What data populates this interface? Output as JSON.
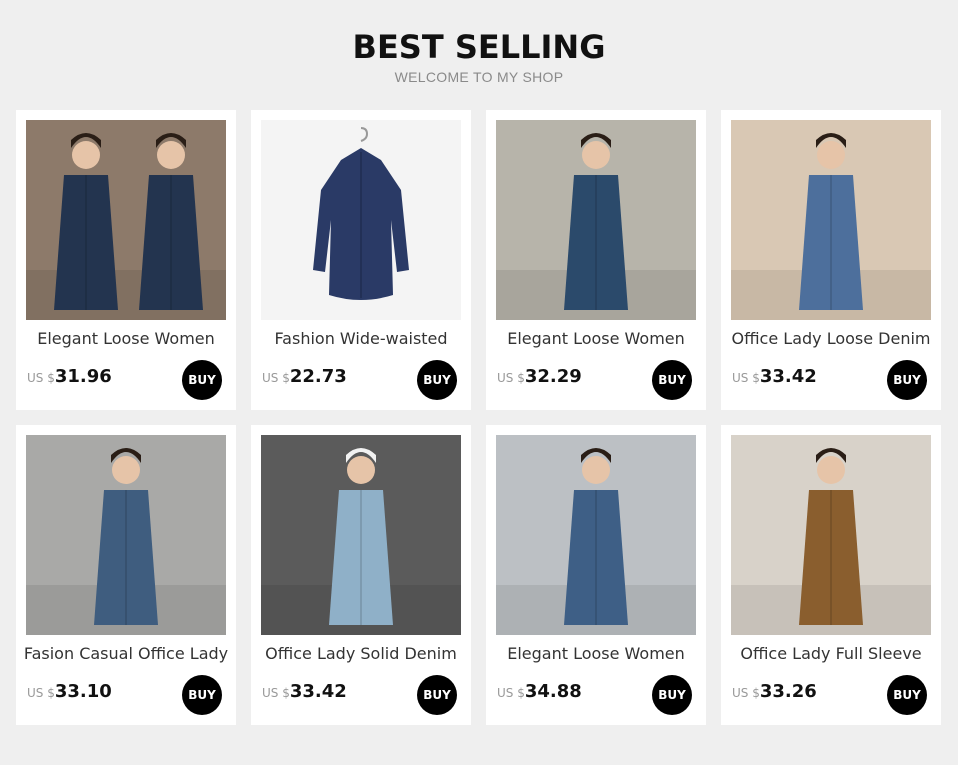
{
  "header": {
    "title": "BEST SELLING",
    "subtitle": "WELCOME TO MY SHOP"
  },
  "currency_label": "US $",
  "buy_label": "BUY",
  "products": [
    {
      "name": "Elegant Loose Women",
      "price": "31.96",
      "image": "woman-denim-trench-front-and-back-photo",
      "colors": {
        "bg": "#8d7a6a",
        "garment": "#23344f"
      }
    },
    {
      "name": "Fashion Wide-waisted",
      "price": "22.73",
      "image": "navy-shirt-dress-on-hanger-photo",
      "colors": {
        "bg": "#f4f4f4",
        "garment": "#2a3a66"
      }
    },
    {
      "name": "Elegant Loose Women",
      "price": "32.29",
      "image": "woman-denim-long-jacket-photo",
      "colors": {
        "bg": "#b7b4aa",
        "garment": "#2b4a6b"
      }
    },
    {
      "name": "Office Lady Loose Denim",
      "price": "33.42",
      "image": "woman-denim-jacket-indoor-photo",
      "colors": {
        "bg": "#d9c8b4",
        "garment": "#4d6f9c"
      }
    },
    {
      "name": "Fasion Casual Office Lady",
      "price": "33.10",
      "image": "woman-denim-double-breasted-coat-photo",
      "colors": {
        "bg": "#a9a9a7",
        "garment": "#3f5d7f"
      }
    },
    {
      "name": "Office Lady Solid Denim",
      "price": "33.42",
      "image": "woman-hooded-denim-coat-back-photo",
      "colors": {
        "bg": "#5b5b5b",
        "garment": "#8fb0c8"
      }
    },
    {
      "name": "Elegant Loose Women",
      "price": "34.88",
      "image": "woman-denim-coat-grey-backdrop-photo",
      "colors": {
        "bg": "#bcc0c4",
        "garment": "#3e5f86"
      }
    },
    {
      "name": "Office Lady Full Sleeve",
      "price": "33.26",
      "image": "woman-brown-long-jacket-photo",
      "colors": {
        "bg": "#d8d2c9",
        "garment": "#8a5e2e"
      }
    }
  ]
}
